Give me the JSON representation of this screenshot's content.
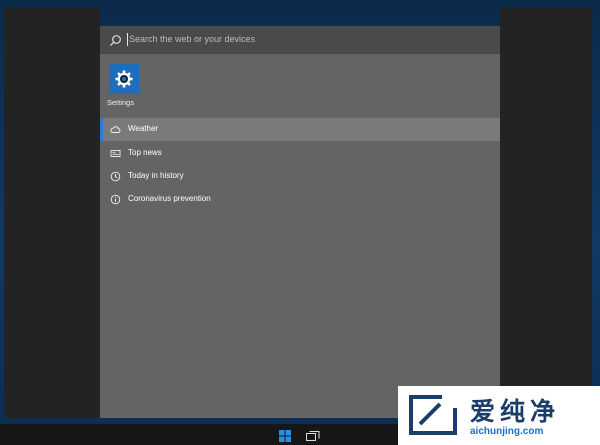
{
  "search": {
    "placeholder": "Search the web or your devices",
    "value": ""
  },
  "top_apps": [
    {
      "label": "Settings",
      "icon": "settings-gear-icon",
      "tile_color": "#1d6fbd"
    }
  ],
  "suggestions": [
    {
      "label": "Weather",
      "icon": "cloud-icon",
      "selected": true
    },
    {
      "label": "Top news",
      "icon": "newspaper-icon",
      "selected": false
    },
    {
      "label": "Today in history",
      "icon": "clock-icon",
      "selected": false
    },
    {
      "label": "Coronavirus prevention",
      "icon": "info-icon",
      "selected": false
    }
  ],
  "taskbar": {
    "buttons": [
      {
        "icon": "windows-start-icon"
      },
      {
        "icon": "task-view-icon"
      }
    ]
  },
  "watermark": {
    "text_cn": "爱纯净",
    "url": "aichunjing.com"
  },
  "colors": {
    "accent": "#2b7bd8",
    "panel": "#646464",
    "search_bar": "#4a4a4a",
    "selected_row": "#7a7a7a",
    "watermark_text": "#1c3c6a",
    "watermark_url": "#1a6fc5"
  }
}
